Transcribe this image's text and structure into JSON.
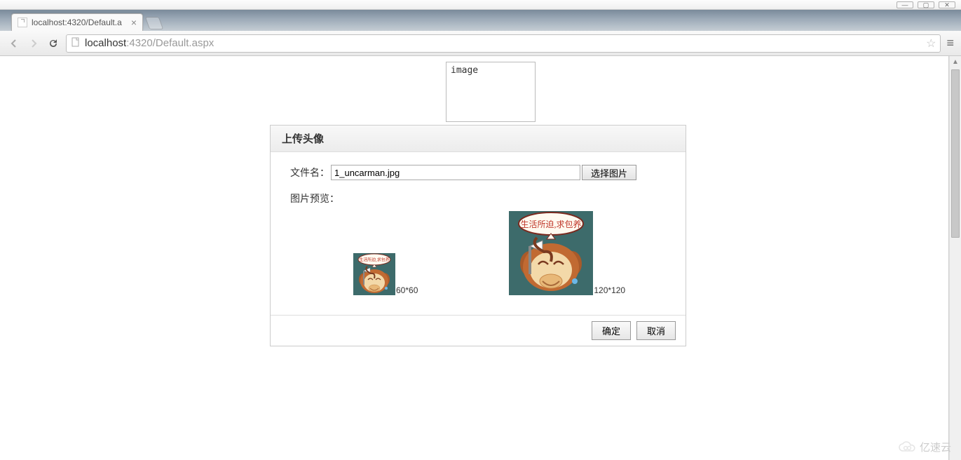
{
  "window": {
    "minimize": "—",
    "maximize": "▢",
    "close": "✕"
  },
  "tab": {
    "title": "localhost:4320/Default.a",
    "close": "×"
  },
  "url": {
    "dim_prefix": "localhost",
    "rest": ":4320/Default.aspx"
  },
  "broken_image_alt": "image",
  "dialog": {
    "title": "上传头像",
    "filename_label": "文件名：",
    "filename_value": "1_uncarman.jpg",
    "choose_button": "选择图片",
    "preview_label": "图片预览：",
    "size_60": "60*60",
    "size_120": "120*120",
    "ok": "确定",
    "cancel": "取消"
  },
  "watermark": "亿速云"
}
